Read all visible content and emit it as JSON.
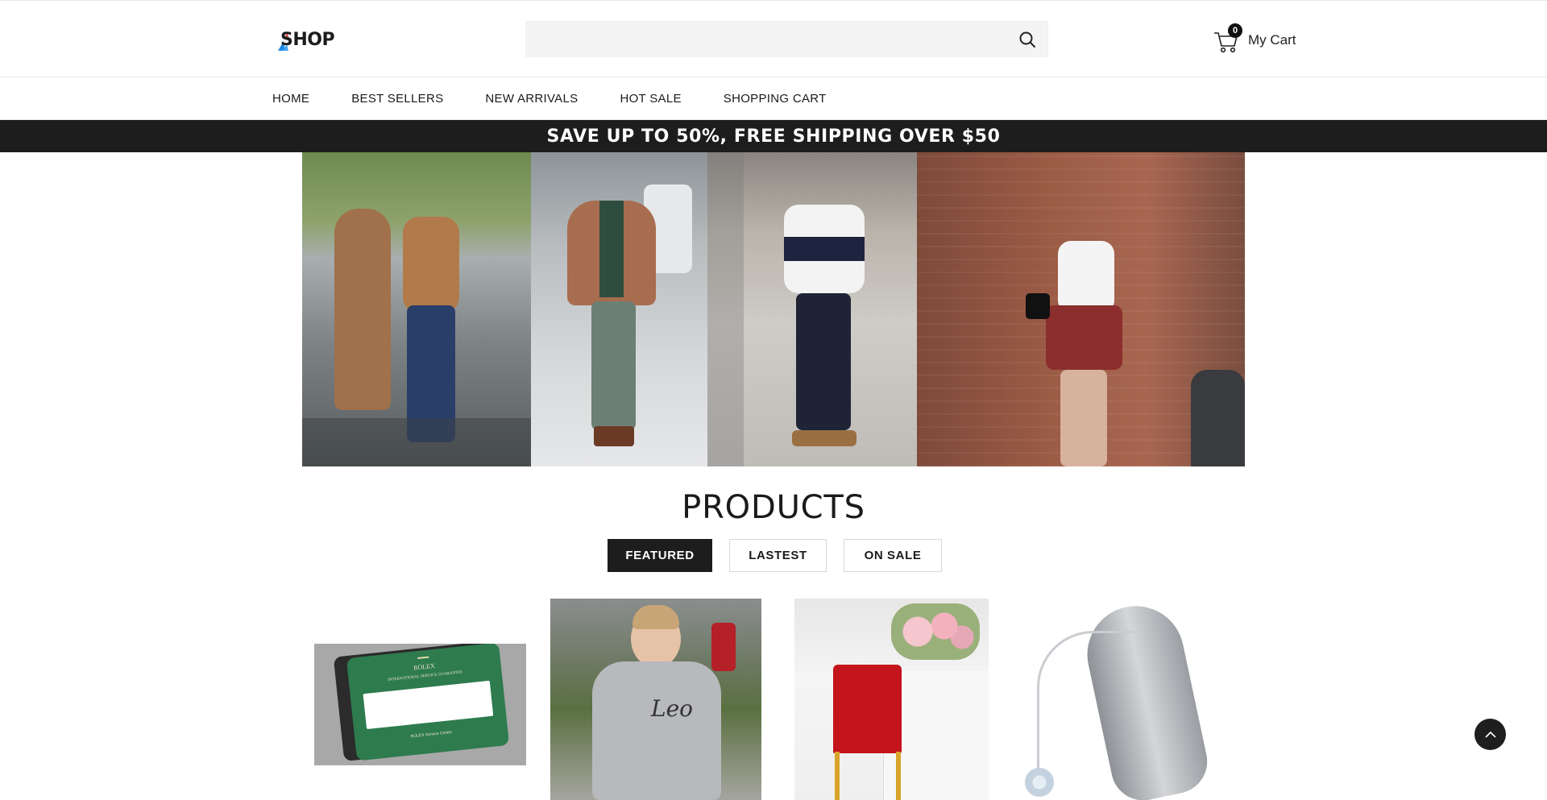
{
  "header": {
    "logo_text": "SHOP",
    "search": {
      "placeholder": "",
      "value": ""
    },
    "cart": {
      "count": "0",
      "label": "My Cart"
    }
  },
  "nav": {
    "items": [
      {
        "label": "HOME"
      },
      {
        "label": "BEST SELLERS"
      },
      {
        "label": "NEW ARRIVALS"
      },
      {
        "label": "HOT SALE"
      },
      {
        "label": "SHOPPING CART"
      }
    ]
  },
  "promo": {
    "text": "SAVE UP TO 50%, FREE SHIPPING OVER $50"
  },
  "products": {
    "title": "PRODUCTS",
    "tabs": [
      {
        "label": "FEATURED",
        "active": true
      },
      {
        "label": "LASTEST",
        "active": false
      },
      {
        "label": "ON SALE",
        "active": false
      }
    ],
    "items": [
      {
        "image": "rolex-service-card",
        "card_brand": "ROLEX",
        "card_title": "INTERNATIONAL SERVICE GUARANTEE",
        "card_footer": "ROLEX Service Centre"
      },
      {
        "image": "toddler-grey-hoodie",
        "hoodie_text": "Leo"
      },
      {
        "image": "red-chair-cover"
      },
      {
        "image": "silver-hearing-aid"
      }
    ]
  },
  "colors": {
    "promo_bg": "#1d1d1d",
    "tab_active_bg": "#1d1d1d",
    "accent_blue": "#1e88e5"
  }
}
